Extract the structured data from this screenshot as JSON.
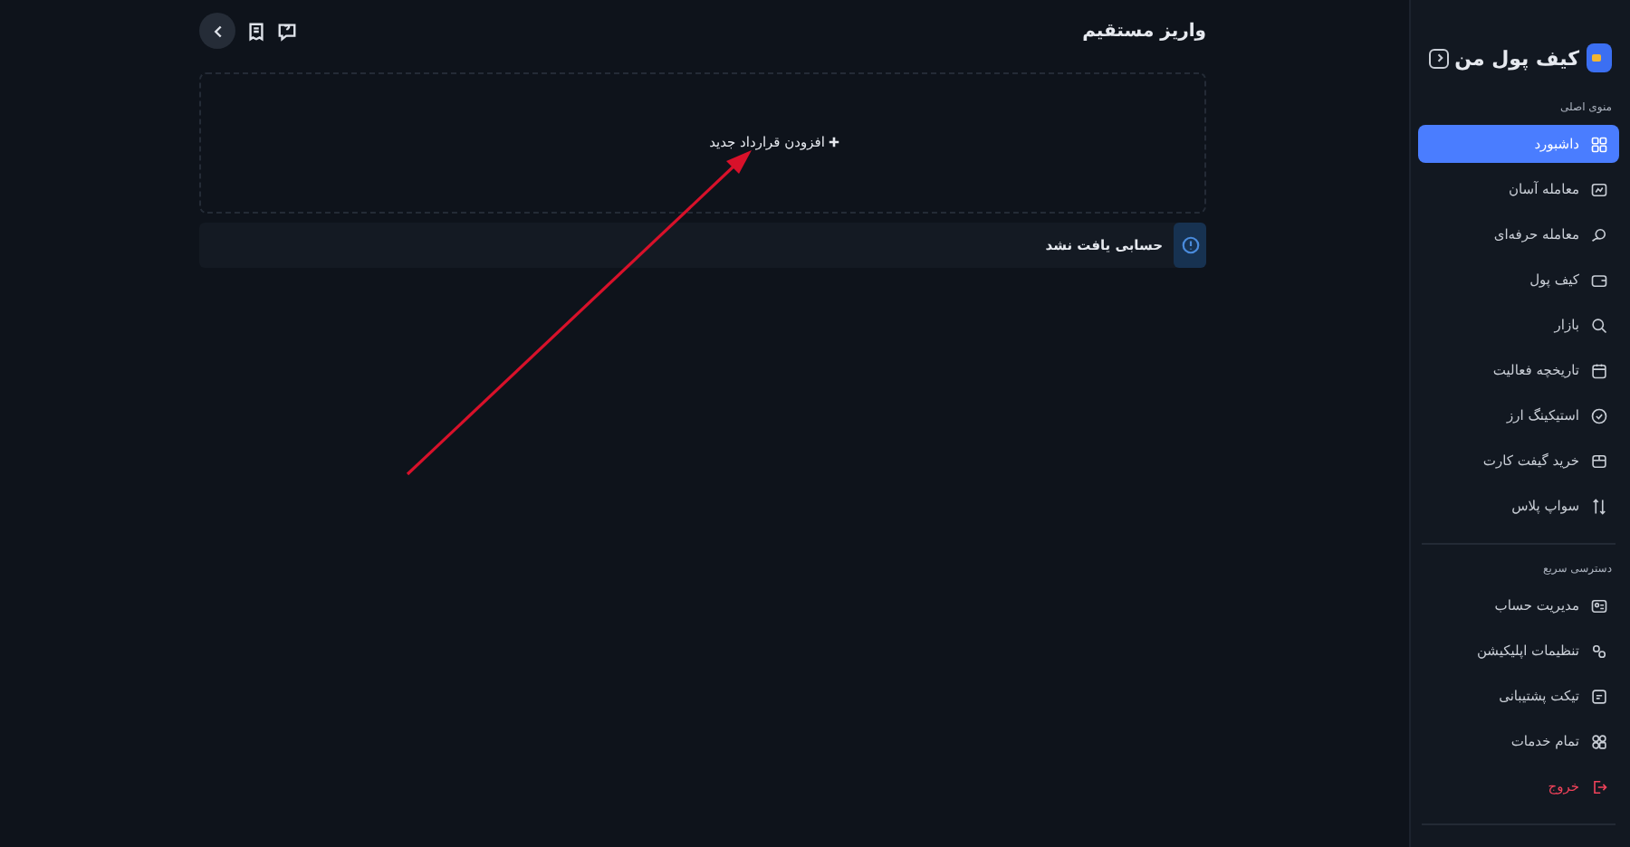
{
  "page": {
    "title": "واریز مستقیم"
  },
  "add_contract": {
    "label": "افزودن قرارداد جدید"
  },
  "notice": {
    "text": "حسابی یافت نشد"
  },
  "sidebar": {
    "brand": "کیف پول من",
    "sections": [
      {
        "title": "منوی اصلی",
        "items": [
          {
            "label": "داشبورد",
            "selected": true,
            "kind": "link"
          },
          {
            "label": "معامله آسان",
            "selected": false,
            "kind": "link"
          },
          {
            "label": "معامله حرفه‌ای",
            "selected": false,
            "kind": "link"
          },
          {
            "label": "کیف پول",
            "selected": false,
            "kind": "link"
          },
          {
            "label": "بازار",
            "selected": false,
            "kind": "link"
          },
          {
            "label": "تاریخچه فعالیت",
            "selected": false,
            "kind": "link"
          },
          {
            "label": "استیکینگ ارز",
            "selected": false,
            "kind": "link"
          },
          {
            "label": "خرید گیفت کارت",
            "selected": false,
            "kind": "link"
          },
          {
            "label": "سواپ پلاس",
            "selected": false,
            "kind": "link"
          }
        ]
      },
      {
        "title": "دسترسی سریع",
        "items": [
          {
            "label": "مدیریت حساب",
            "selected": false,
            "kind": "link"
          },
          {
            "label": "تنظیمات اپلیکیشن",
            "selected": false,
            "kind": "link"
          },
          {
            "label": "تیکت پشتیبانی",
            "selected": false,
            "kind": "link"
          },
          {
            "label": "تمام خدمات",
            "selected": false,
            "kind": "link"
          },
          {
            "label": "خروج",
            "selected": false,
            "kind": "logout"
          }
        ]
      }
    ]
  }
}
